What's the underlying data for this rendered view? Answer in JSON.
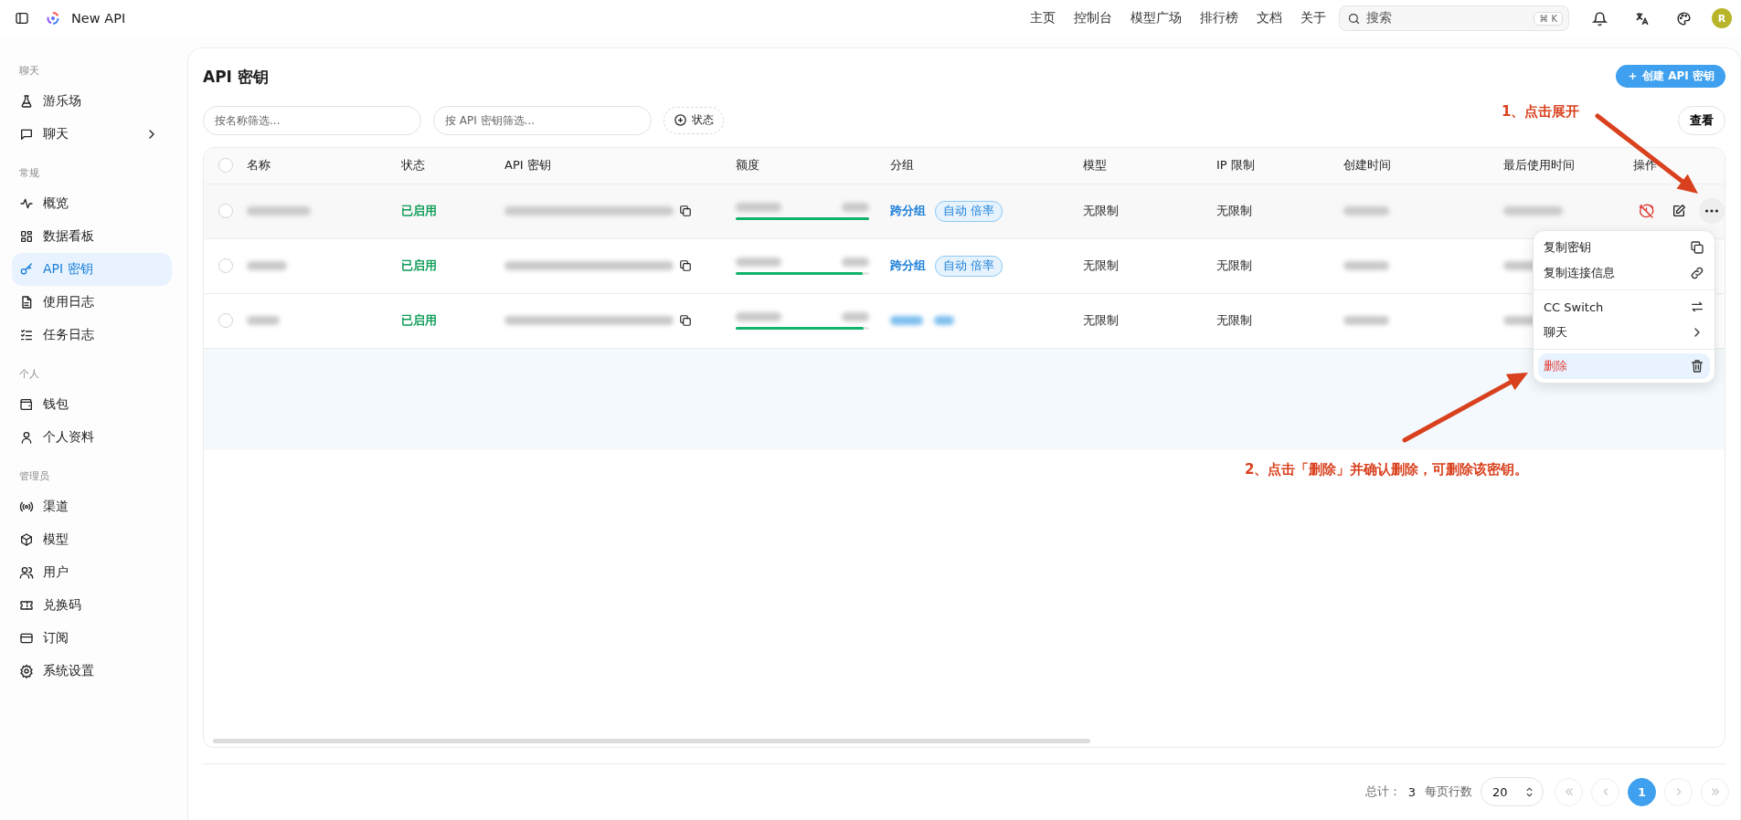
{
  "topbar": {
    "brand": "New API",
    "nav": [
      {
        "label": "主页"
      },
      {
        "label": "控制台"
      },
      {
        "label": "模型广场"
      },
      {
        "label": "排行榜"
      },
      {
        "label": "文档"
      },
      {
        "label": "关于"
      }
    ],
    "search": {
      "placeholder": "搜索",
      "shortcut": [
        "⌘",
        "K"
      ]
    },
    "avatar": "R"
  },
  "sidebar": {
    "sections": [
      {
        "title": "聊天",
        "items": [
          {
            "label": "游乐场",
            "selected": false,
            "has_submenu": false
          },
          {
            "label": "聊天",
            "selected": false,
            "has_submenu": true
          }
        ]
      },
      {
        "title": "常规",
        "items": [
          {
            "label": "概览",
            "selected": false,
            "has_submenu": false
          },
          {
            "label": "数据看板",
            "selected": false,
            "has_submenu": false
          },
          {
            "label": "API 密钥",
            "selected": true,
            "has_submenu": false
          },
          {
            "label": "使用日志",
            "selected": false,
            "has_submenu": false
          },
          {
            "label": "任务日志",
            "selected": false,
            "has_submenu": false
          }
        ]
      },
      {
        "title": "个人",
        "items": [
          {
            "label": "钱包",
            "selected": false,
            "has_submenu": false
          },
          {
            "label": "个人资料",
            "selected": false,
            "has_submenu": false
          }
        ]
      },
      {
        "title": "管理员",
        "items": [
          {
            "label": "渠道",
            "selected": false,
            "has_submenu": false
          },
          {
            "label": "模型",
            "selected": false,
            "has_submenu": false
          },
          {
            "label": "用户",
            "selected": false,
            "has_submenu": false
          },
          {
            "label": "兑换码",
            "selected": false,
            "has_submenu": false
          },
          {
            "label": "订阅",
            "selected": false,
            "has_submenu": false
          },
          {
            "label": "系统设置",
            "selected": false,
            "has_submenu": false
          }
        ]
      }
    ]
  },
  "page": {
    "title": "API 密钥",
    "create_button": "创建 API 密钥",
    "filters": [
      {
        "placeholder": "按名称筛选..."
      },
      {
        "placeholder": "按 API 密钥筛选..."
      }
    ],
    "status_filter": "状态",
    "view_button": "查看"
  },
  "table": {
    "all_selected": false,
    "columns": [
      "名称",
      "状态",
      "API 密钥",
      "额度",
      "分组",
      "模型",
      "IP 限制",
      "创建时间",
      "最后使用时间",
      "操作"
    ],
    "rows": [
      {
        "hovered": true,
        "selected": false,
        "status": "已启用",
        "level": 1,
        "group": "跨分组",
        "group_tag": "自动 倍率",
        "model": "无限制",
        "ip_limit": "无限制"
      },
      {
        "hovered": false,
        "selected": false,
        "status": "已启用",
        "level": 0.95,
        "group": "跨分组",
        "group_tag": "自动 倍率",
        "model": "无限制",
        "ip_limit": "无限制"
      },
      {
        "hovered": false,
        "selected": false,
        "status": "已启用",
        "level": 0.96,
        "model": "无限制",
        "ip_limit": "无限制"
      }
    ]
  },
  "menu": {
    "groups": [
      [
        {
          "label": "复制密钥",
          "kind": "copy",
          "selected": false
        },
        {
          "label": "复制连接信息",
          "kind": "link",
          "selected": false
        }
      ],
      [
        {
          "label": "CC Switch",
          "kind": "switch",
          "selected": false
        },
        {
          "label": "聊天",
          "kind": "submenu",
          "selected": false
        }
      ],
      [
        {
          "label": "删除",
          "kind": "delete",
          "selected": true
        }
      ]
    ]
  },
  "annotations": [
    {
      "text": "1、点击展开"
    },
    {
      "text": "2、点击「删除」并确认删除，可删除该密钥。"
    }
  ],
  "pagination": {
    "total_label": "总计：",
    "total": "3",
    "page_size_label": "每页行数",
    "page_size": "20",
    "pages": [
      {
        "label": "1",
        "selected": true
      }
    ],
    "nav_buttons": [
      {
        "kind": "first",
        "disabled": true
      },
      {
        "kind": "prev",
        "disabled": true
      },
      {
        "kind": "next",
        "disabled": true
      },
      {
        "kind": "last",
        "disabled": true
      }
    ]
  }
}
